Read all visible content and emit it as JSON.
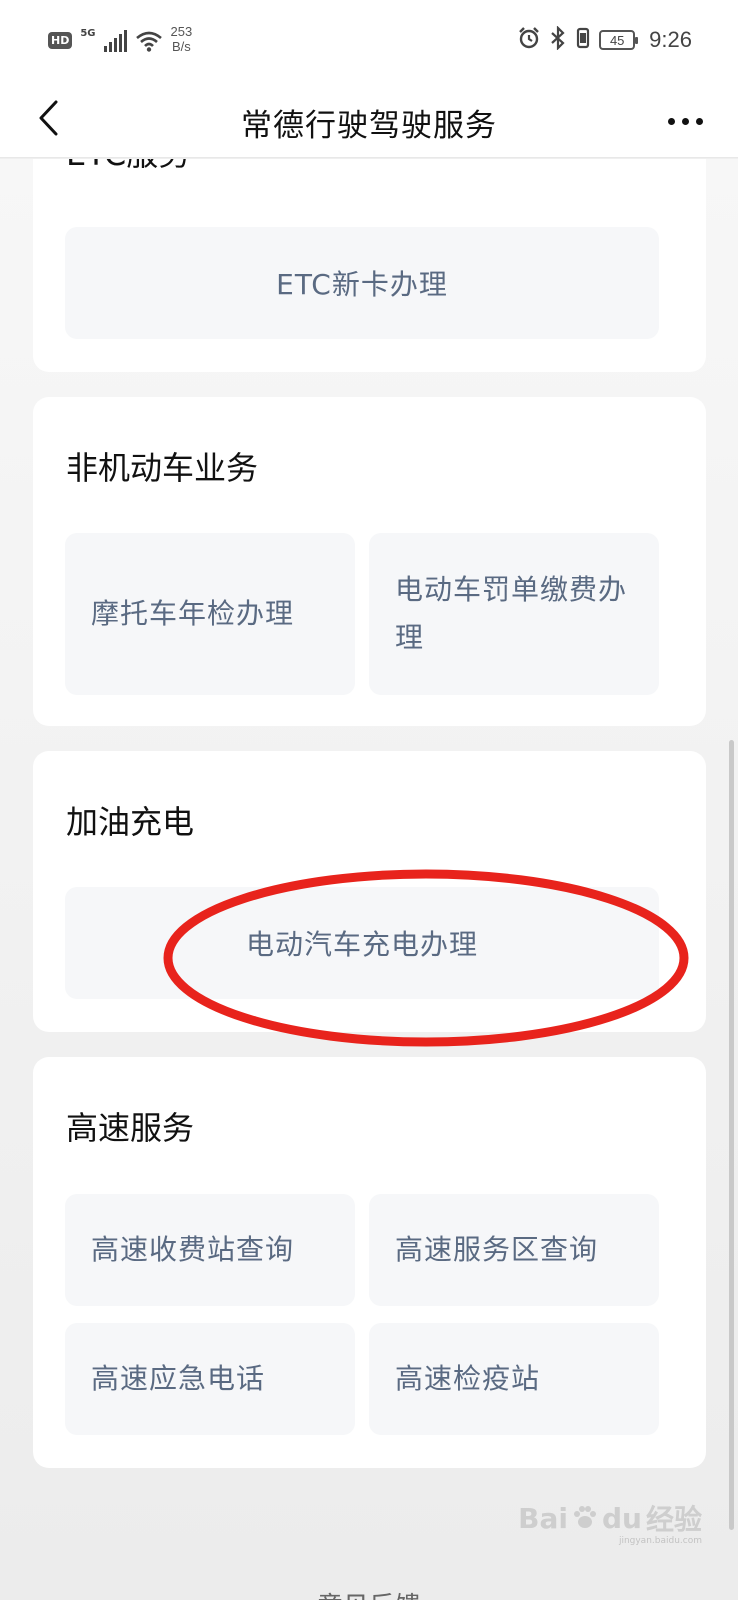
{
  "status_bar": {
    "hd": "HD",
    "network": "5G",
    "net_speed_value": "253",
    "net_speed_unit": "B/s",
    "battery": "45",
    "time": "9:26"
  },
  "nav": {
    "title": "常德行驶驾驶服务"
  },
  "sections": {
    "etc": {
      "title": "ETC服务",
      "items": [
        "ETC新卡办理"
      ]
    },
    "non_motor": {
      "title": "非机动车业务",
      "items": [
        "摩托车年检办理",
        "电动车罚单缴费办理"
      ]
    },
    "fuel_charge": {
      "title": "加油充电",
      "items": [
        "电动汽车充电办理"
      ]
    },
    "highway": {
      "title": "高速服务",
      "items": [
        "高速收费站查询",
        "高速服务区查询",
        "高速应急电话",
        "高速检疫站"
      ]
    }
  },
  "footer": {
    "feedback": "意见反馈"
  },
  "watermark": {
    "brand": "Bai",
    "brand2": "du",
    "brand_cn": "经验",
    "url": "jingyan.baidu.com"
  },
  "colors": {
    "highlight_ellipse": "#e8231c",
    "tile_text": "#5a6a82",
    "tile_bg": "#f6f7f9"
  }
}
